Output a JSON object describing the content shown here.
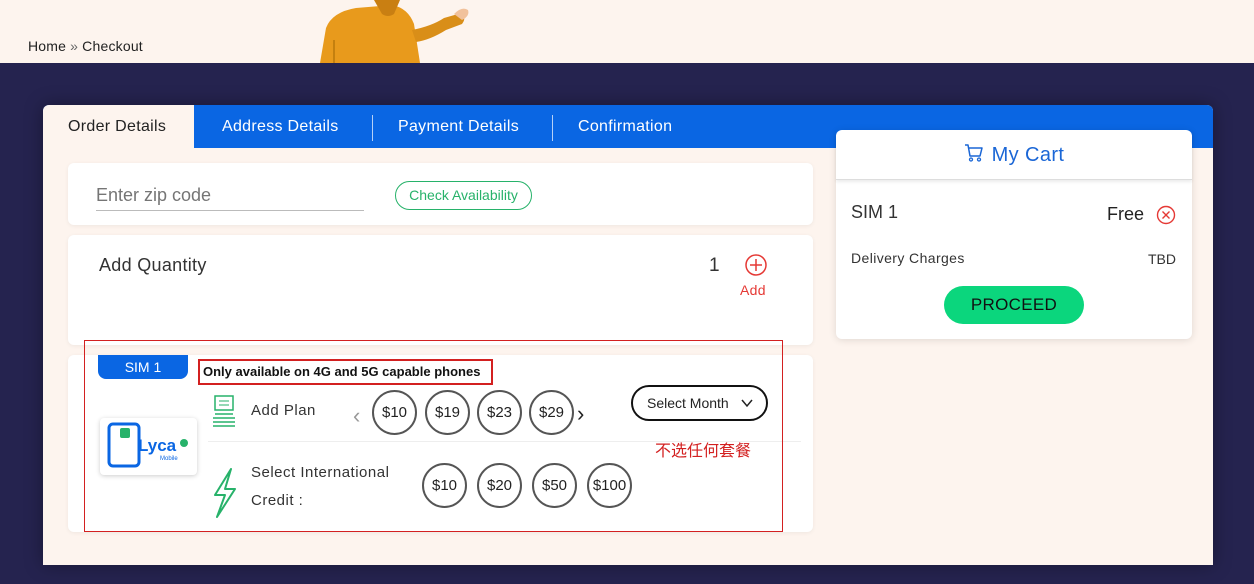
{
  "breadcrumb": {
    "home": "Home",
    "separator": "»",
    "current": "Checkout"
  },
  "tabs": [
    {
      "label": "Order Details",
      "active": true
    },
    {
      "label": "Address Details",
      "active": false
    },
    {
      "label": "Payment Details",
      "active": false
    },
    {
      "label": "Confirmation",
      "active": false
    }
  ],
  "zip": {
    "placeholder": "Enter zip code",
    "value": "",
    "check_label": "Check Availability"
  },
  "quantity": {
    "title": "Add Quantity",
    "value": "1",
    "add_label": "Add"
  },
  "sim": {
    "badge": "SIM 1",
    "brand": "Lyca",
    "brand_sub": "Mobile",
    "note": "Only available on 4G and 5G capable phones",
    "plan_label": "Add Plan",
    "plans": [
      "$10",
      "$19",
      "$23",
      "$29"
    ],
    "select_month": "Select Month",
    "annotation": "不选任何套餐",
    "intl_label_line1": "Select International",
    "intl_label_line2": "Credit :",
    "credits": [
      "$10",
      "$20",
      "$50",
      "$100"
    ]
  },
  "cart": {
    "title": "My Cart",
    "item": "SIM 1",
    "price": "Free",
    "delivery_label": "Delivery Charges",
    "delivery_value": "TBD",
    "proceed_label": "PROCEED"
  },
  "colors": {
    "brand_blue": "#0a66e3",
    "navy_background": "#25234f",
    "cream": "#fdf4ee",
    "accent_green": "#0bd67d",
    "alert_red": "#d32020"
  }
}
